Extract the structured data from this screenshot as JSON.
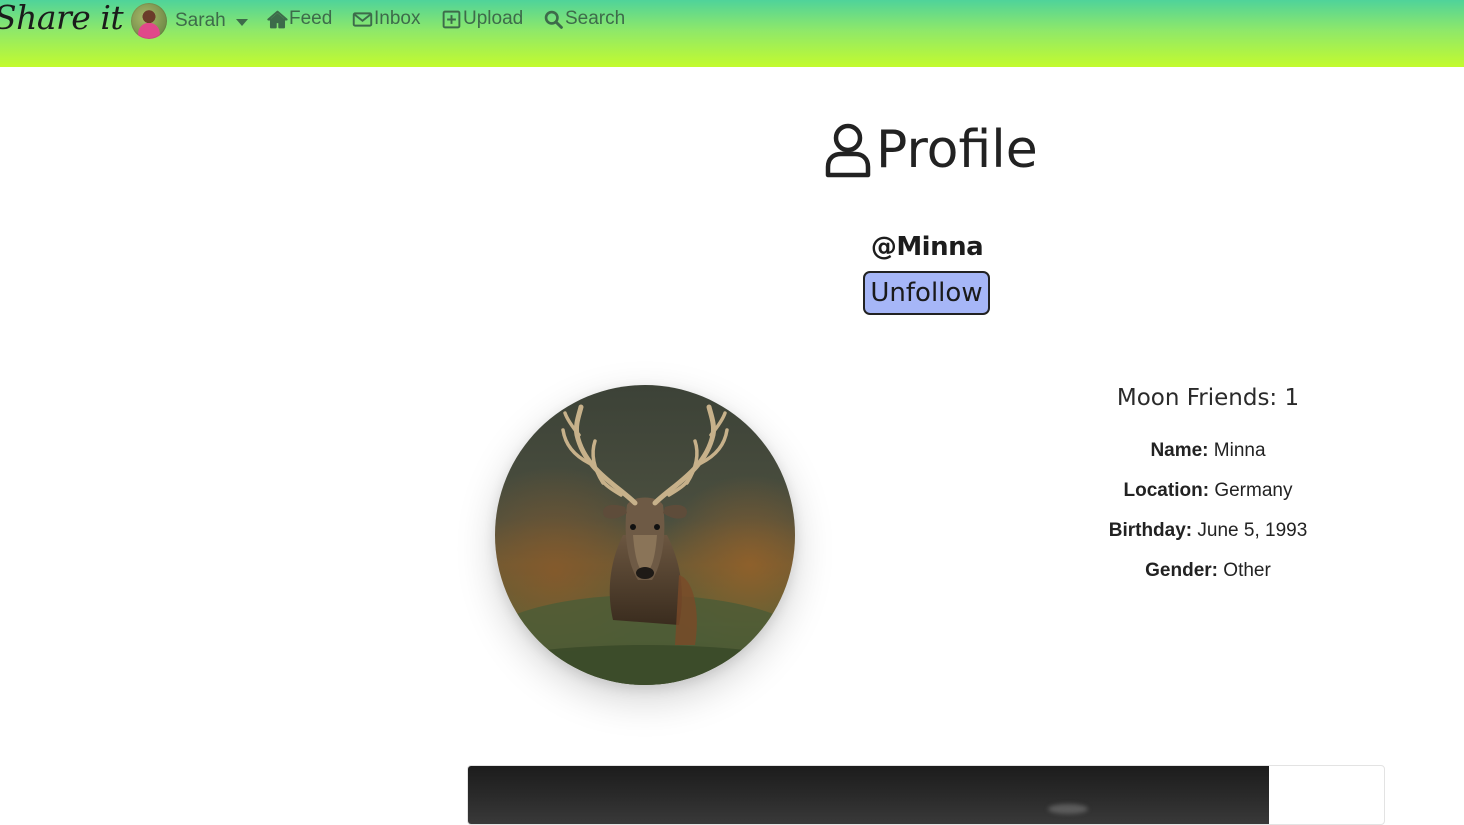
{
  "navbar": {
    "brand": "Share it",
    "user_name": "Sarah",
    "feed_label": "Feed",
    "inbox_label": "Inbox",
    "upload_label": "Upload",
    "search_label": "Search",
    "gradient_colors": [
      "#4fd39a",
      "#c3fb2e"
    ],
    "link_color": "#3d6b4a"
  },
  "profile": {
    "title": "Profile",
    "handle": "@Minna",
    "unfollow_label": "Unfollow",
    "unfollow_color": "#a6b6f7",
    "moon_friends": "Moon Friends: 1",
    "info": [
      {
        "key": "Name:",
        "value": "Minna"
      },
      {
        "key": "Location:",
        "value": "Germany"
      },
      {
        "key": "Birthday:",
        "value": "June 5, 1993"
      },
      {
        "key": "Gender:",
        "value": "Other"
      }
    ]
  },
  "icons": {
    "feed": "home-icon",
    "inbox": "envelope-icon",
    "upload": "plus-square-icon",
    "search": "search-icon",
    "title": "user-icon"
  }
}
